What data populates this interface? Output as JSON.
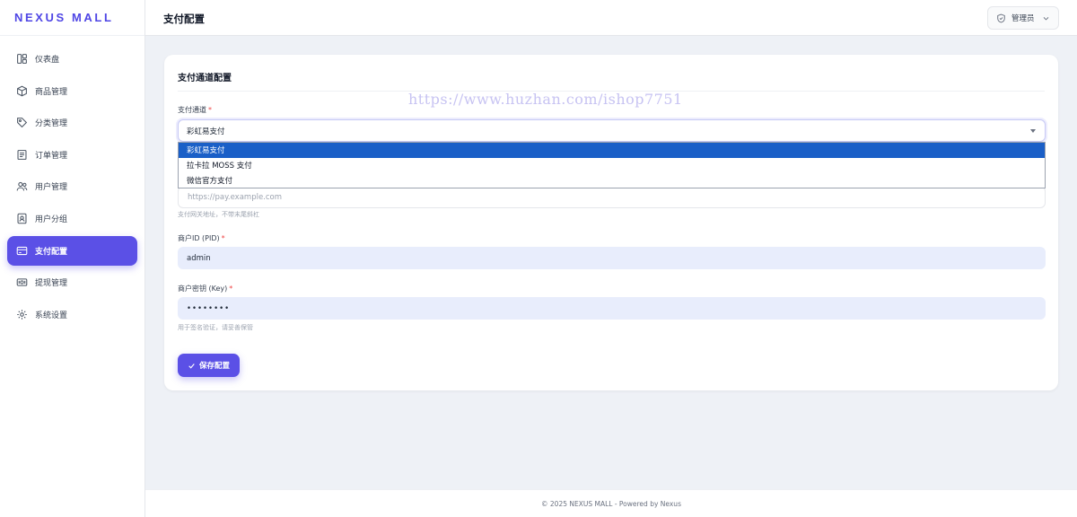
{
  "brand": "NEXUS MALL",
  "sidebar": {
    "items": [
      {
        "label": "仪表盘",
        "icon": "dashboard-icon"
      },
      {
        "label": "商品管理",
        "icon": "box-icon"
      },
      {
        "label": "分类管理",
        "icon": "tag-icon"
      },
      {
        "label": "订单管理",
        "icon": "receipt-icon"
      },
      {
        "label": "用户管理",
        "icon": "users-icon"
      },
      {
        "label": "用户分组",
        "icon": "user-badge-icon"
      },
      {
        "label": "支付配置",
        "icon": "credit-card-icon",
        "active": true
      },
      {
        "label": "提现管理",
        "icon": "wallet-icon"
      },
      {
        "label": "系统设置",
        "icon": "gear-icon"
      }
    ]
  },
  "header": {
    "title": "支付配置",
    "admin_label": "管理员"
  },
  "card": {
    "title": "支付通道配置",
    "watermark": "https://www.huzhan.com/ishop7751",
    "channel": {
      "label": "支付通道",
      "required": "*",
      "value": "彩虹易支付",
      "options": [
        "彩虹易支付",
        "拉卡拉 MOSS 支付",
        "微信官方支付"
      ]
    },
    "gateway": {
      "placeholder": "https://pay.example.com",
      "hint": "支付网关地址，不带末尾斜杠"
    },
    "pid": {
      "label": "商户ID (PID)",
      "required": "*",
      "value": "admin"
    },
    "key": {
      "label": "商户密钥 (Key)",
      "required": "*",
      "value": "••••••••",
      "hint": "用于签名验证，请妥善保管"
    },
    "save_label": "保存配置"
  },
  "footer": "© 2025 NEXUS MALL - Powered by Nexus",
  "colors": {
    "accent": "#5b50e6",
    "dropdown_selected": "#1a5fc7",
    "required": "#ef4444"
  }
}
